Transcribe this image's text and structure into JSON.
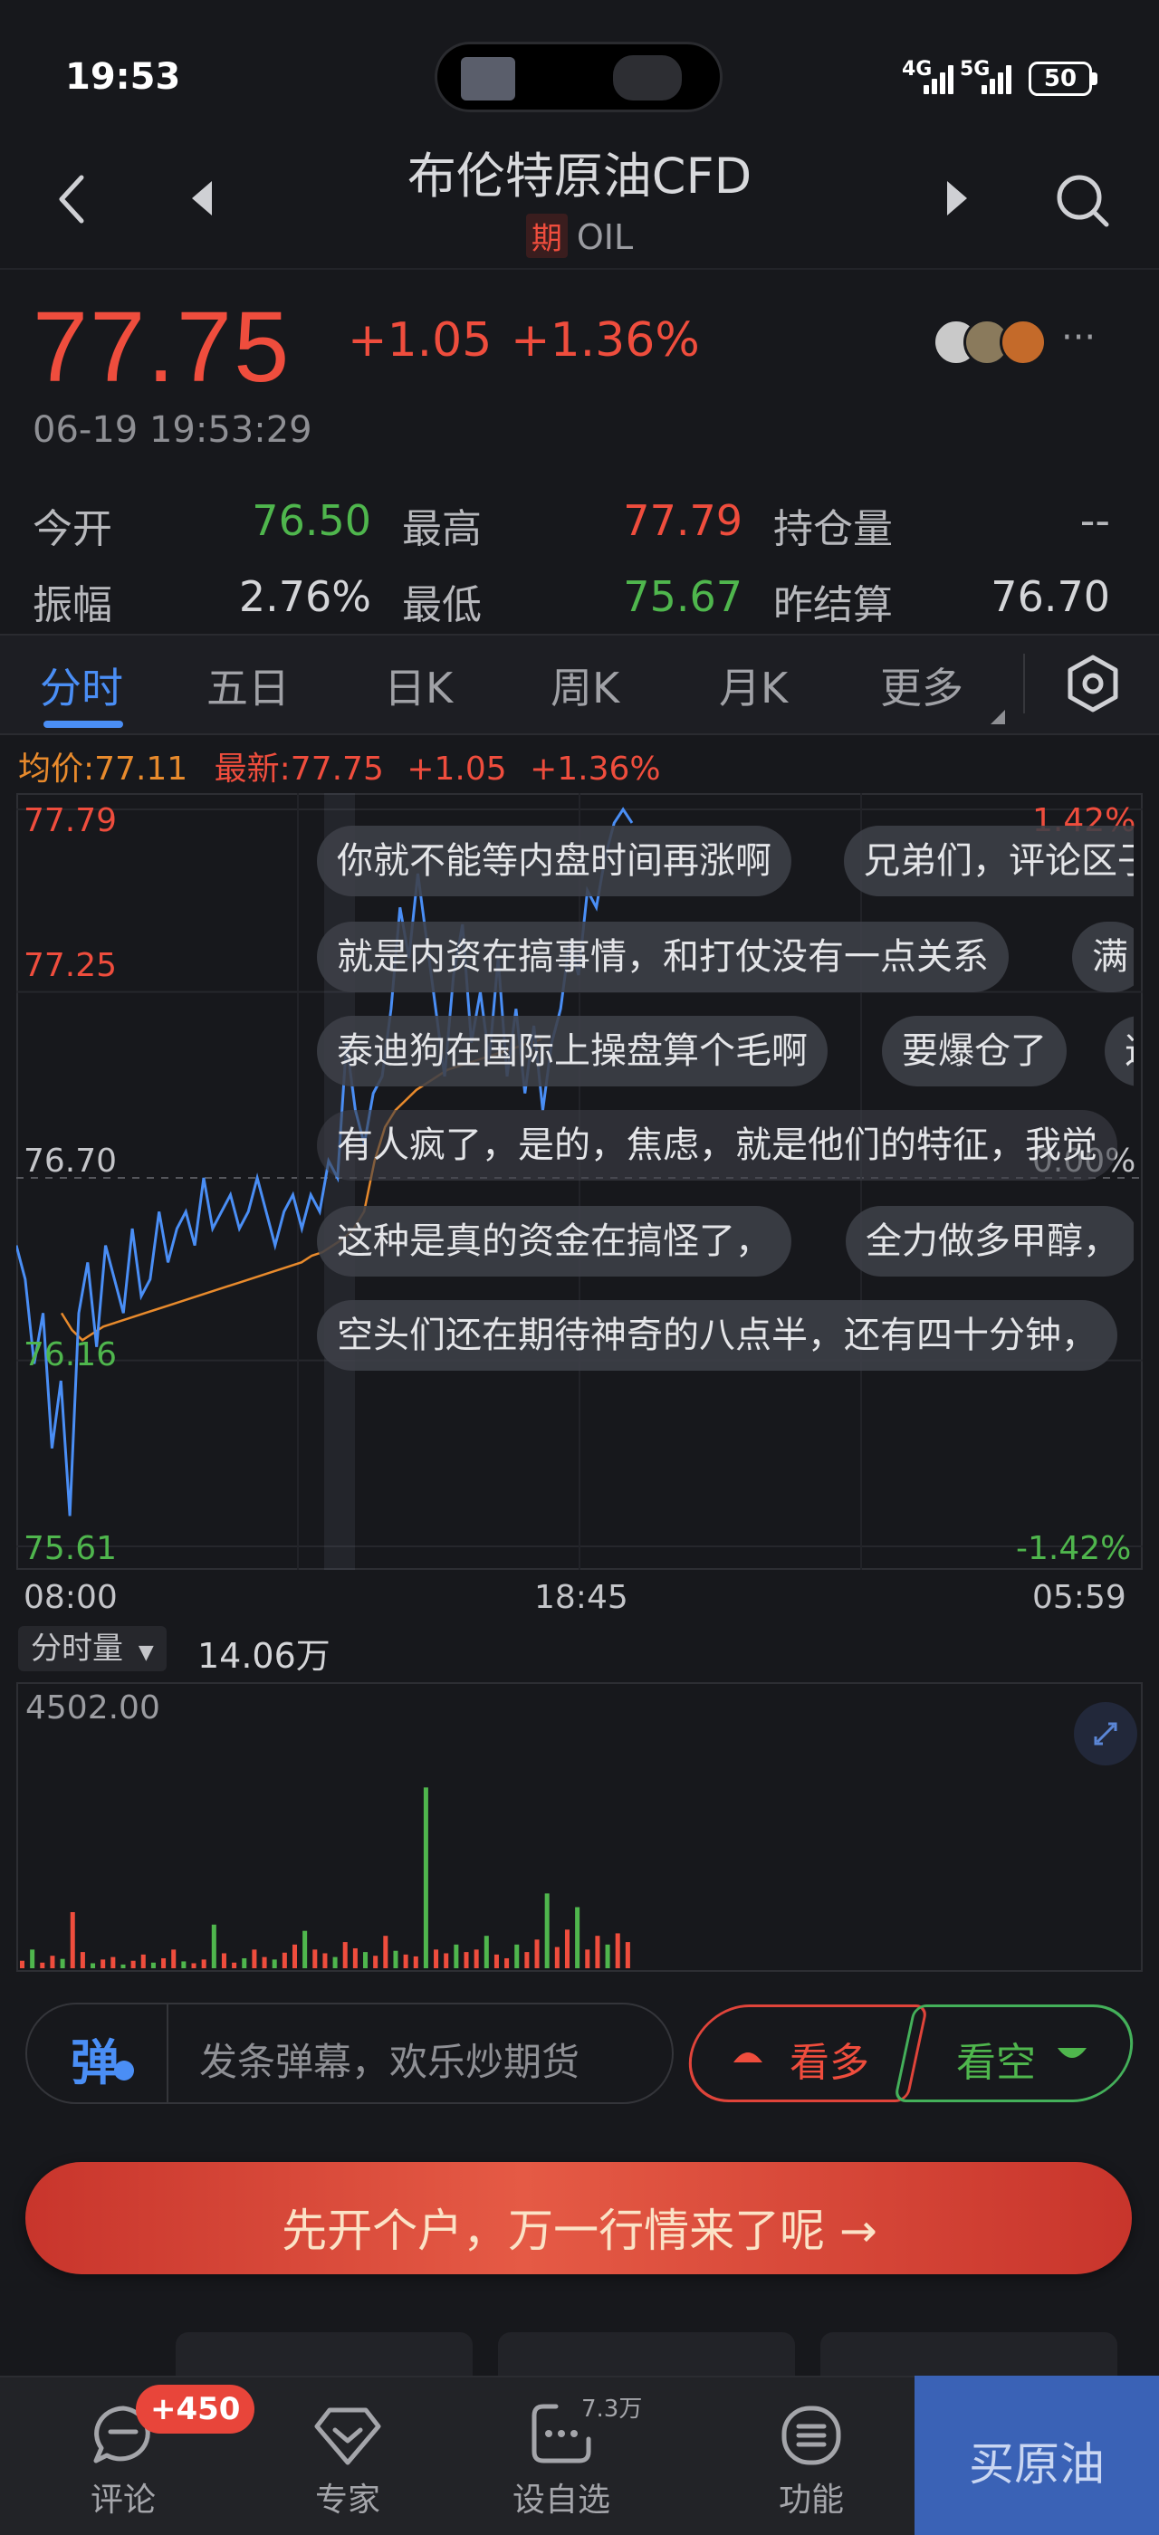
{
  "status_bar": {
    "time": "19:53",
    "net1": "4G",
    "net2": "5G",
    "battery": "50"
  },
  "header": {
    "title": "布伦特原油CFD",
    "badge": "期",
    "code": "OIL"
  },
  "quote": {
    "price": "77.75",
    "change": "+1.05",
    "change_pct": "+1.36%",
    "time": "06-19 19:53:29"
  },
  "stats": {
    "open_label": "今开",
    "open": "76.50",
    "high_label": "最高",
    "high": "77.79",
    "oi_label": "持仓量",
    "oi": "--",
    "amp_label": "振幅",
    "amp": "2.76%",
    "low_label": "最低",
    "low": "75.67",
    "prev_label": "昨结算",
    "prev": "76.70"
  },
  "tabs": [
    "分时",
    "五日",
    "日K",
    "周K",
    "月K",
    "更多"
  ],
  "info_line": {
    "avg": "均价:77.11",
    "latest": "最新:77.75",
    "chg": "+1.05",
    "pct": "+1.36%"
  },
  "colors": {
    "up": "#ef4d3d",
    "down": "#4fb64d",
    "accent": "#4a8ef5",
    "avg_line": "#e88a2c"
  },
  "chart_data": {
    "type": "line",
    "y_ticks": [
      "77.79",
      "77.25",
      "76.70",
      "76.16",
      "75.61"
    ],
    "pct_ticks": [
      "1.42%",
      "0.00%",
      "-1.42%"
    ],
    "x_ticks": [
      "08:00",
      "18:45",
      "05:59"
    ],
    "ylim": [
      75.61,
      77.79
    ],
    "reference": 76.7,
    "series": [
      {
        "name": "price",
        "values": [
          76.5,
          76.4,
          76.15,
          76.3,
          75.9,
          76.1,
          75.7,
          76.3,
          76.45,
          76.2,
          76.5,
          76.4,
          76.3,
          76.55,
          76.35,
          76.4,
          76.6,
          76.45,
          76.55,
          76.6,
          76.5,
          76.7,
          76.55,
          76.6,
          76.65,
          76.55,
          76.6,
          76.7,
          76.6,
          76.5,
          76.6,
          76.65,
          76.55,
          76.65,
          76.6,
          76.75,
          76.7,
          77.1,
          76.9,
          76.8,
          76.95,
          77.0,
          77.2,
          77.5,
          77.35,
          77.6,
          77.4,
          77.2,
          77.0,
          77.3,
          77.45,
          77.1,
          77.25,
          77.05,
          77.35,
          77.0,
          77.2,
          76.95,
          77.15,
          76.9,
          77.1,
          77.2,
          77.4,
          77.3,
          77.55,
          77.5,
          77.65,
          77.75,
          77.79,
          77.75
        ]
      },
      {
        "name": "avg",
        "values": [
          76.3,
          76.25,
          76.22,
          76.24,
          76.26,
          76.27,
          76.28,
          76.29,
          76.3,
          76.31,
          76.32,
          76.33,
          76.34,
          76.35,
          76.36,
          76.37,
          76.38,
          76.39,
          76.4,
          76.41,
          76.42,
          76.43,
          76.44,
          76.45,
          76.47,
          76.48,
          76.5,
          76.52,
          76.55,
          76.6,
          76.75,
          76.85,
          76.9,
          76.93,
          76.96,
          76.98,
          77.0,
          77.02,
          77.03,
          77.04,
          77.05,
          77.06,
          77.07,
          77.08,
          77.09,
          77.1,
          77.11
        ]
      }
    ]
  },
  "danmaku": [
    [
      "你就不能等内盘时间再涨啊",
      "兄弟们，评论区子"
    ],
    [
      "就是内资在搞事情，和打仗没有一点关系",
      "满"
    ],
    [
      "泰迪狗在国际上操盘算个毛啊",
      "要爆仓了",
      "这"
    ],
    [
      "有人疯了，是的，焦虑，就是他们的特征，我觉"
    ],
    [
      "这种是真的资金在搞怪了，",
      "全力做多甲醇，"
    ],
    [
      "空头们还在期待神奇的八点半，还有四十分钟，"
    ]
  ],
  "volume": {
    "selector": "分时量",
    "total": "14.06万",
    "max": "4502.00",
    "values": [
      120,
      300,
      90,
      200,
      150,
      900,
      260,
      80,
      140,
      180,
      60,
      120,
      220,
      90,
      160,
      300,
      110,
      80,
      140,
      700,
      240,
      90,
      160,
      300,
      180,
      140,
      250,
      380,
      600,
      300,
      240,
      180,
      420,
      320,
      260,
      200,
      520,
      280,
      220,
      190,
      2900,
      300,
      240,
      380,
      260,
      300,
      520,
      220,
      160,
      380,
      260,
      460,
      1200,
      340,
      620,
      980,
      300,
      520,
      380,
      560,
      420
    ]
  },
  "input": {
    "danmu_icon": "弹",
    "placeholder": "发条弹幕，欢乐炒期货",
    "bull": "看多",
    "bear": "看空"
  },
  "promo": {
    "text": "先开个户，万一行情来了呢 →"
  },
  "nav": {
    "comment": "评论",
    "comment_badge": "+450",
    "expert": "专家",
    "watch": "设自选",
    "watch_count": "7.3万",
    "func": "功能",
    "buy": "买原油"
  }
}
